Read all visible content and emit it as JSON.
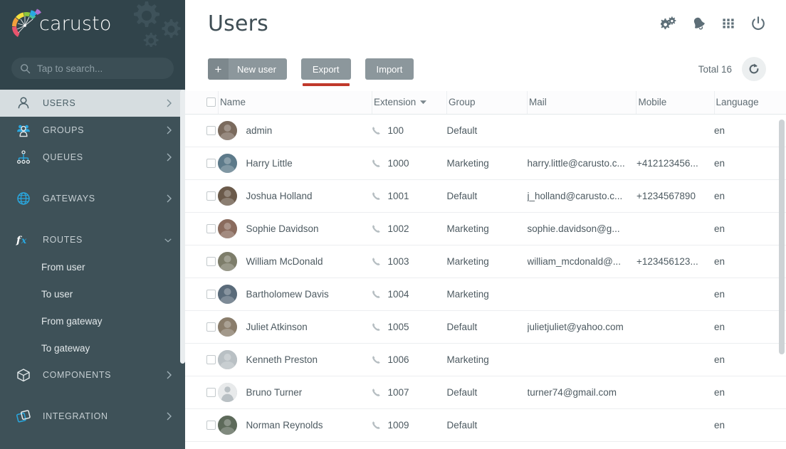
{
  "brand": {
    "name": "carusto",
    "logo_icon": "carusto-fan-logo",
    "gears_icon": "gears-decoration"
  },
  "search": {
    "placeholder": "Tap to search...",
    "value": "",
    "icon": "search-icon"
  },
  "sidebar": {
    "items": [
      {
        "label": "USERS",
        "icon": "user-icon",
        "chevron": "chevron-right-icon",
        "active": true
      },
      {
        "label": "GROUPS",
        "icon": "groups-icon",
        "chevron": "chevron-right-icon",
        "active": false
      },
      {
        "label": "QUEUES",
        "icon": "queues-icon",
        "chevron": "chevron-right-icon",
        "active": false
      },
      {
        "label": "GATEWAYS",
        "icon": "globe-icon",
        "chevron": "chevron-right-icon",
        "active": false
      },
      {
        "label": "ROUTES",
        "icon": "fx-icon",
        "chevron": "chevron-down-icon",
        "active": false
      },
      {
        "label": "COMPONENTS",
        "icon": "cube-icon",
        "chevron": "chevron-right-icon",
        "active": false
      },
      {
        "label": "INTEGRATION",
        "icon": "integration-icon",
        "chevron": "chevron-right-icon",
        "active": false
      }
    ],
    "routes_subitems": [
      {
        "label": "From user"
      },
      {
        "label": "To user"
      },
      {
        "label": "From gateway"
      },
      {
        "label": "To gateway"
      }
    ]
  },
  "header": {
    "title": "Users",
    "icons": [
      {
        "name": "settings-gears-icon"
      },
      {
        "name": "bell-icon"
      },
      {
        "name": "apps-grid-icon"
      },
      {
        "name": "power-icon"
      }
    ]
  },
  "toolbar": {
    "new_user_label": "New user",
    "new_user_plus": "+",
    "export_label": "Export",
    "import_label": "Import",
    "total_label": "Total 16",
    "refresh_icon": "refresh-icon",
    "highlight_color": "#c0392b"
  },
  "table": {
    "columns": [
      {
        "key": "check",
        "label": ""
      },
      {
        "key": "name",
        "label": "Name"
      },
      {
        "key": "extension",
        "label": "Extension",
        "sorted": true,
        "sort_icon": "caret-down-icon"
      },
      {
        "key": "group",
        "label": "Group"
      },
      {
        "key": "mail",
        "label": "Mail"
      },
      {
        "key": "mobile",
        "label": "Mobile"
      },
      {
        "key": "language",
        "label": "Language"
      }
    ],
    "rows": [
      {
        "name": "admin",
        "extension": "100",
        "group": "Default",
        "mail": "",
        "mobile": "",
        "language": "en",
        "avatar": "photo"
      },
      {
        "name": "Harry Little",
        "extension": "1000",
        "group": "Marketing",
        "mail": "harry.little@carusto.c...",
        "mobile": "+412123456...",
        "language": "en",
        "avatar": "photo"
      },
      {
        "name": "Joshua Holland",
        "extension": "1001",
        "group": "Default",
        "mail": "j_holland@carusto.c...",
        "mobile": "+1234567890",
        "language": "en",
        "avatar": "photo"
      },
      {
        "name": "Sophie Davidson",
        "extension": "1002",
        "group": "Marketing",
        "mail": "sophie.davidson@g...",
        "mobile": "",
        "language": "en",
        "avatar": "photo"
      },
      {
        "name": "William McDonald",
        "extension": "1003",
        "group": "Marketing",
        "mail": "william_mcdonald@...",
        "mobile": "+123456123...",
        "language": "en",
        "avatar": "photo"
      },
      {
        "name": "Bartholomew Davis",
        "extension": "1004",
        "group": "Marketing",
        "mail": "",
        "mobile": "",
        "language": "en",
        "avatar": "photo"
      },
      {
        "name": "Juliet Atkinson",
        "extension": "1005",
        "group": "Default",
        "mail": "julietjuliet@yahoo.com",
        "mobile": "",
        "language": "en",
        "avatar": "photo"
      },
      {
        "name": "Kenneth Preston",
        "extension": "1006",
        "group": "Marketing",
        "mail": "",
        "mobile": "",
        "language": "en",
        "avatar": "photo"
      },
      {
        "name": "Bruno Turner",
        "extension": "1007",
        "group": "Default",
        "mail": "turner74@gmail.com",
        "mobile": "",
        "language": "en",
        "avatar": "placeholder"
      },
      {
        "name": "Norman Reynolds",
        "extension": "1009",
        "group": "Default",
        "mail": "",
        "mobile": "",
        "language": "en",
        "avatar": "photo"
      }
    ]
  },
  "colors": {
    "sidebar_bg": "#3e5158",
    "sidebar_dark": "#31444b",
    "accent_blue": "#29a8e0",
    "button_gray": "#8c979c",
    "highlight_red": "#c0392b"
  }
}
